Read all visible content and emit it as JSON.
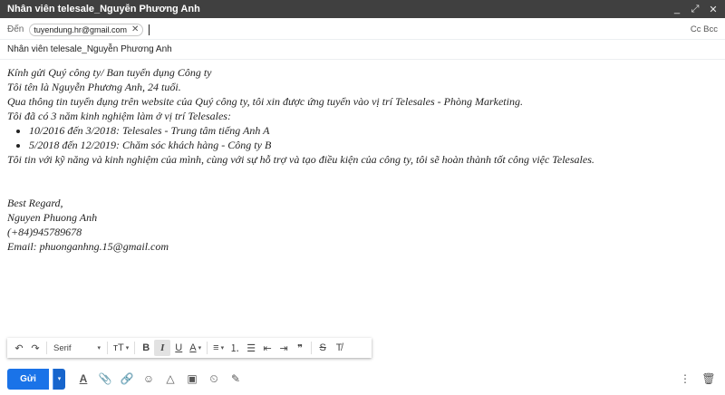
{
  "window": {
    "title": "Nhân viên telesale_Nguyễn Phương Anh",
    "minimize_glyph": "_",
    "expand_glyph": "⤢",
    "close_glyph": "✕"
  },
  "recipients": {
    "to_label": "Đến",
    "chip_email": "tuyendung.hr@gmail.com",
    "chip_remove": "✕",
    "cc_bcc": "Cc Bcc"
  },
  "subject": "Nhân viên telesale_Nguyễn Phương Anh",
  "body": {
    "lines": [
      "Kính gửi Quý công ty/ Ban tuyển dụng Công ty",
      "Tôi tên là Nguyễn Phương Anh, 24 tuổi.",
      "Qua thông tin tuyển dụng trên website của Quý công ty, tôi xin được ứng tuyển vào vị trí Telesales - Phòng Marketing.",
      "Tôi đã có 3 năm kinh nghiệm làm ở vị trí Telesales:"
    ],
    "bullets": [
      "10/2016 đến 3/2018: Telesales - Trung tâm tiếng Anh A",
      "5/2018 đến 12/2019: Chăm sóc khách hàng - Công ty B"
    ],
    "closing_line": "Tôi tin với kỹ năng và kinh nghiệm của mình, cùng với sự hỗ trợ và tạo điều kiện của công ty, tôi sẽ hoàn thành tốt công việc Telesales.",
    "signature": [
      "Best Regard,",
      "Nguyen Phuong Anh",
      "(+84)945789678",
      "Email: phuonganhng.15@gmail.com"
    ]
  },
  "formatting": {
    "undo_glyph": "↶",
    "redo_glyph": "↷",
    "font_name": "Serif",
    "size_glyph": "тT",
    "bold_glyph": "B",
    "italic_glyph": "I",
    "underline_glyph": "U",
    "text_color_glyph": "A",
    "align_glyph": "≡",
    "numbered_glyph": "⒈",
    "bulleted_glyph": "☰",
    "indent_less_glyph": "⇤",
    "indent_more_glyph": "⇥",
    "quote_glyph": "❞",
    "strike_glyph": "S",
    "clear_glyph": "T̸",
    "caret_glyph": "▾"
  },
  "actions": {
    "send_label": "Gửi",
    "send_more_glyph": "▾",
    "format_glyph": "A",
    "attach_glyph": "📎",
    "link_glyph": "🔗",
    "emoji_glyph": "☺",
    "drive_glyph": "△",
    "photo_glyph": "▣",
    "confidential_glyph": "⏲",
    "signature_glyph": "✎",
    "more_glyph": "⋮",
    "trash_glyph": "🗑"
  },
  "colors": {
    "titlebar": "#404040",
    "send_button": "#1a73e8"
  }
}
